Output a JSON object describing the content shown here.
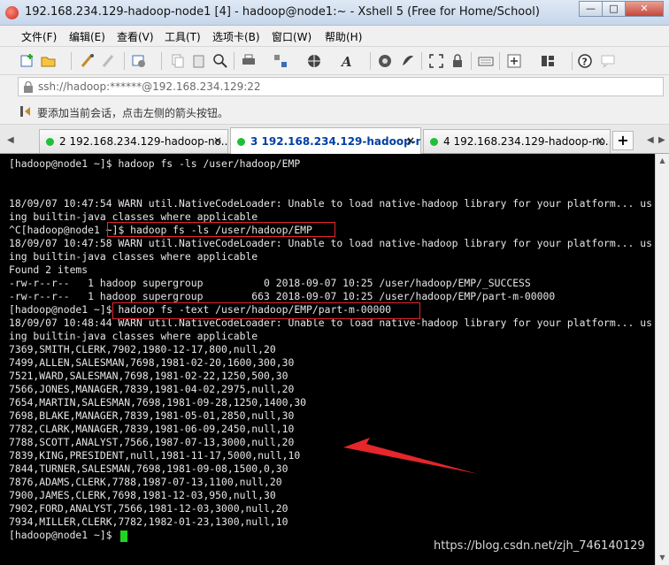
{
  "window": {
    "title": "192.168.234.129-hadoop-node1 [4] - hadoop@node1:~ - Xshell 5 (Free for Home/School)",
    "minimize": "—",
    "maximize": "□",
    "close": "✕"
  },
  "menu": {
    "items": [
      "文件(F)",
      "编辑(E)",
      "查看(V)",
      "工具(T)",
      "选项卡(B)",
      "窗口(W)",
      "帮助(H)"
    ]
  },
  "address": {
    "value": "ssh://hadoop:******@192.168.234.129:22"
  },
  "hint": {
    "text": "要添加当前会话，点击左侧的箭头按钮。"
  },
  "tabs": {
    "items": [
      {
        "label": "2 192.168.234.129-hadoop-no...",
        "close": "×"
      },
      {
        "label": "3 192.168.234.129-hadoop-n...",
        "close": "×"
      },
      {
        "label": "4 192.168.234.129-hadoop-no...",
        "close": "×"
      }
    ],
    "add": "+",
    "left_arrow": "◀",
    "right_arrow": "▶"
  },
  "terminal": {
    "lines": [
      "[hadoop@node1 ~]$ hadoop fs -ls /user/hadoop/EMP",
      "",
      "",
      "18/09/07 10:47:54 WARN util.NativeCodeLoader: Unable to load native-hadoop library for your platform... us",
      "ing builtin-java classes where applicable",
      "^C[hadoop@node1 ~]$ hadoop fs -ls /user/hadoop/EMP",
      "18/09/07 10:47:58 WARN util.NativeCodeLoader: Unable to load native-hadoop library for your platform... us",
      "ing builtin-java classes where applicable",
      "Found 2 items",
      "-rw-r--r--   1 hadoop supergroup          0 2018-09-07 10:25 /user/hadoop/EMP/_SUCCESS",
      "-rw-r--r--   1 hadoop supergroup        663 2018-09-07 10:25 /user/hadoop/EMP/part-m-00000",
      "[hadoop@node1 ~]$ hadoop fs -text /user/hadoop/EMP/part-m-00000",
      "18/09/07 10:48:44 WARN util.NativeCodeLoader: Unable to load native-hadoop library for your platform... us",
      "ing builtin-java classes where applicable",
      "7369,SMITH,CLERK,7902,1980-12-17,800,null,20",
      "7499,ALLEN,SALESMAN,7698,1981-02-20,1600,300,30",
      "7521,WARD,SALESMAN,7698,1981-02-22,1250,500,30",
      "7566,JONES,MANAGER,7839,1981-04-02,2975,null,20",
      "7654,MARTIN,SALESMAN,7698,1981-09-28,1250,1400,30",
      "7698,BLAKE,MANAGER,7839,1981-05-01,2850,null,30",
      "7782,CLARK,MANAGER,7839,1981-06-09,2450,null,10",
      "7788,SCOTT,ANALYST,7566,1987-07-13,3000,null,20",
      "7839,KING,PRESIDENT,null,1981-11-17,5000,null,10",
      "7844,TURNER,SALESMAN,7698,1981-09-08,1500,0,30",
      "7876,ADAMS,CLERK,7788,1987-07-13,1100,null,20",
      "7900,JAMES,CLERK,7698,1981-12-03,950,null,30",
      "7902,FORD,ANALYST,7566,1981-12-03,3000,null,20",
      "7934,MILLER,CLERK,7782,1982-01-23,1300,null,10",
      "[hadoop@node1 ~]$ "
    ]
  },
  "watermark": "https://blog.csdn.net/zjh_746140129",
  "colors": {
    "terminal_bg": "#000000",
    "terminal_fg": "#e6e6e6",
    "cursor": "#1dd61d",
    "annotation": "#e5262a",
    "active_tab_text": "#003fa3",
    "tab_status": "#1ebf39"
  },
  "icons": [
    "new-session-icon",
    "open-icon",
    "reconnect-icon",
    "disconnect-icon",
    "properties-icon",
    "copy-icon",
    "paste-icon",
    "find-icon",
    "print-icon",
    "transfer-icon",
    "globe-icon",
    "font-icon",
    "xftp-icon",
    "script-icon",
    "fullscreen-icon",
    "lock-icon",
    "keyboard-icon",
    "add-icon",
    "layout-icon",
    "help-icon",
    "chat-icon"
  ]
}
